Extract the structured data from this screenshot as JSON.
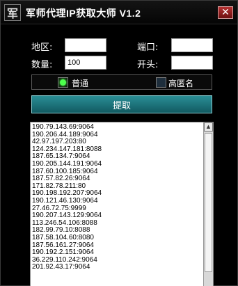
{
  "window": {
    "icon_glyph": "军",
    "title": "军师代理IP获取大师 V1.2",
    "close_glyph": "✕"
  },
  "form": {
    "region_label": "地区:",
    "region_value": "",
    "port_label": "端口:",
    "port_value": "",
    "quantity_label": "数量:",
    "quantity_value": "100",
    "prefix_label": "开头:",
    "prefix_value": ""
  },
  "mode": {
    "normal_label": "普通",
    "normal_checked": true,
    "anonymous_label": "高匿名",
    "anonymous_checked": false
  },
  "fetch_button": "提取",
  "results": [
    "190.79.143.69:9064",
    "190.206.44.189:9064",
    "42.97.197.203:80",
    "124.234.147.181:8088",
    "187.65.134.7:9064",
    "190.205.144.191:9064",
    "187.60.100.185:9064",
    "187.57.82.26:9064",
    "171.82.78.211:80",
    "190.198.192.207:9064",
    "190.121.46.130:9064",
    "27.46.72.75:9999",
    "190.207.143.129:9064",
    "113.246.54.106:8088",
    "182.99.79.10:8088",
    "187.58.104.60:8080",
    "187.56.161.27:9064",
    "190.192.2.151:9064",
    "36.229.110.242:9064",
    "201.92.43.17:9064"
  ]
}
